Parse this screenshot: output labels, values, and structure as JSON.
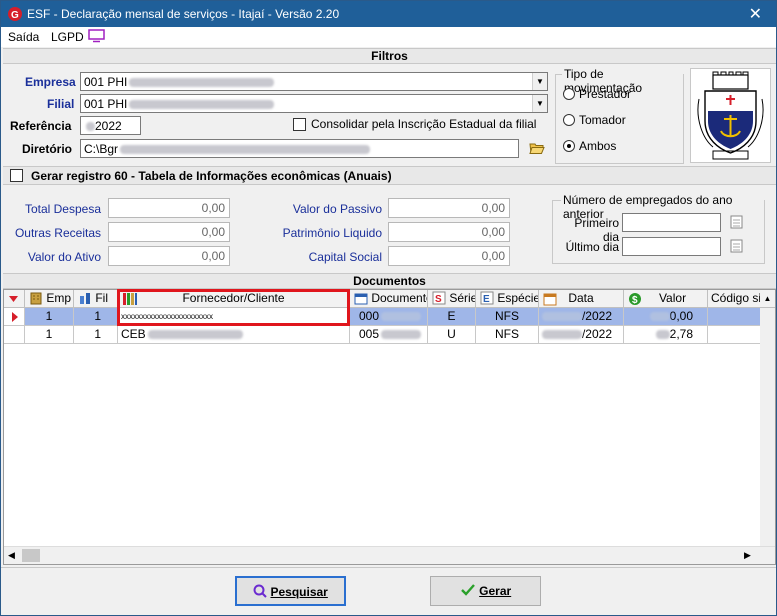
{
  "window": {
    "title": "ESF - Declaração mensal de serviços - Itajaí - Versão 2.20",
    "close": "✕"
  },
  "menu": {
    "saida": "Saída",
    "lgpd": "LGPD"
  },
  "filtros": {
    "heading": "Filtros",
    "empresa_label": "Empresa",
    "empresa_value": "001 PHI",
    "filial_label": "Filial",
    "filial_value": "001 PHI",
    "referencia_label": "Referência",
    "referencia_value": "2022",
    "consolidar_label": "Consolidar pela Inscrição Estadual da filial",
    "diretorio_label": "Diretório",
    "diretorio_value": "C:\\Bgr",
    "tipo_title": "Tipo de movimentação",
    "tipo_options": [
      "Prestador",
      "Tomador",
      "Ambos"
    ],
    "tipo_selected": "Ambos"
  },
  "registro60": {
    "label": "Gerar registro 60 - Tabela de Informações econômicas (Anuais)",
    "total_despesa_label": "Total Despesa",
    "total_despesa": "0,00",
    "outras_receitas_label": "Outras Receitas",
    "outras_receitas": "0,00",
    "valor_ativo_label": "Valor do Ativo",
    "valor_ativo": "0,00",
    "valor_passivo_label": "Valor do Passivo",
    "valor_passivo": "0,00",
    "patrimonio_label": "Patrimônio Liquido",
    "patrimonio": "0,00",
    "capital_label": "Capital Social",
    "capital": "0,00",
    "empregados_title": "Número de empregados do ano anterior",
    "primeiro_dia_label": "Primeiro dia",
    "ultimo_dia_label": "Último dia"
  },
  "documentos": {
    "heading": "Documentos",
    "columns": [
      "Emp",
      "Fil",
      "Fornecedor/Cliente",
      "Documento",
      "Série",
      "Espécie",
      "Data",
      "Valor",
      "Código sit"
    ],
    "rows": [
      {
        "emp": "1",
        "fil": "1",
        "fornecedor": "xxxxxxxxxxxxxxxxxxxxxxx",
        "documento": "000",
        "serie": "E",
        "especie": "NFS",
        "data": "/2022",
        "valor": "0,00"
      },
      {
        "emp": "1",
        "fil": "1",
        "fornecedor": "CEB",
        "documento": "005",
        "serie": "U",
        "especie": "NFS",
        "data": "/2022",
        "valor": "2,78"
      }
    ]
  },
  "buttons": {
    "pesquisar": "Pesquisar",
    "gerar": "Gerar"
  },
  "colors": {
    "titlebar": "#1f5f99",
    "label_blue": "#1a2f9a",
    "selected_row": "#9fb6e8",
    "highlight_red": "#e0161d"
  }
}
